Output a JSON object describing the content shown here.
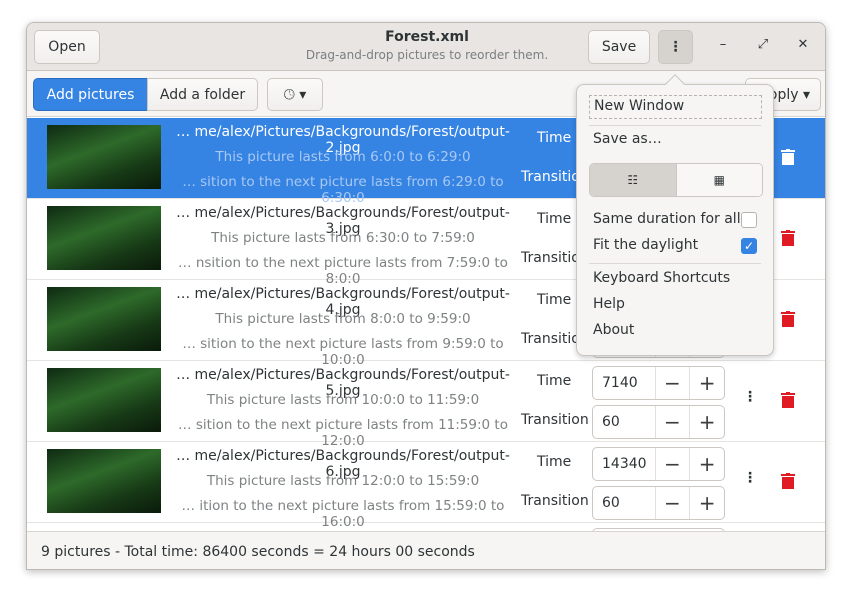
{
  "header": {
    "title": "Forest.xml",
    "subtitle": "Drag-and-drop pictures to reorder them.",
    "open_label": "Open",
    "save_label": "Save"
  },
  "toolbar": {
    "add_pictures": "Add pictures",
    "add_folder": "Add a folder",
    "apply_label": "Apply"
  },
  "rows": [
    {
      "path": "… me/alex/Pictures/Backgrounds/Forest/output-2.jpg",
      "lasts": "This picture lasts from 6:0:0 to 6:29:0",
      "transition": "… sition to the next picture lasts from 6:29:0 to 6:30:0",
      "time_label": "Time",
      "transition_label": "Transition",
      "time": "",
      "trans": "",
      "selected": true
    },
    {
      "path": "… me/alex/Pictures/Backgrounds/Forest/output-3.jpg",
      "lasts": "This picture lasts from 6:30:0 to 7:59:0",
      "transition": "… nsition to the next picture lasts from 7:59:0 to 8:0:0",
      "time_label": "Time",
      "transition_label": "Transition",
      "time": "",
      "trans": ""
    },
    {
      "path": "… me/alex/Pictures/Backgrounds/Forest/output-4.jpg",
      "lasts": "This picture lasts from 8:0:0 to 9:59:0",
      "transition": "… sition to the next picture lasts from 9:59:0 to 10:0:0",
      "time_label": "Time",
      "transition_label": "Transition",
      "time": "",
      "trans": ""
    },
    {
      "path": "… me/alex/Pictures/Backgrounds/Forest/output-5.jpg",
      "lasts": "This picture lasts from 10:0:0 to 11:59:0",
      "transition": "… sition to the next picture lasts from 11:59:0 to 12:0:0",
      "time_label": "Time",
      "transition_label": "Transition",
      "time": "7140",
      "trans": "60"
    },
    {
      "path": "… me/alex/Pictures/Backgrounds/Forest/output-6.jpg",
      "lasts": "This picture lasts from 12:0:0 to 15:59:0",
      "transition": "… ition to the next picture lasts from 15:59:0 to 16:0:0",
      "time_label": "Time",
      "transition_label": "Transition",
      "time": "14340",
      "trans": "60"
    }
  ],
  "status": "9 pictures - Total time: 86400 seconds = 24 hours 00 seconds",
  "menu": {
    "new_window": "New Window",
    "save_as": "Save as…",
    "same_duration": "Same duration for all",
    "same_duration_checked": false,
    "fit_daylight": "Fit the daylight",
    "fit_daylight_checked": true,
    "shortcuts": "Keyboard Shortcuts",
    "help": "Help",
    "about": "About",
    "view_mode": "list"
  },
  "colors": {
    "accent": "#3584e4",
    "delete": "#e01b24"
  }
}
